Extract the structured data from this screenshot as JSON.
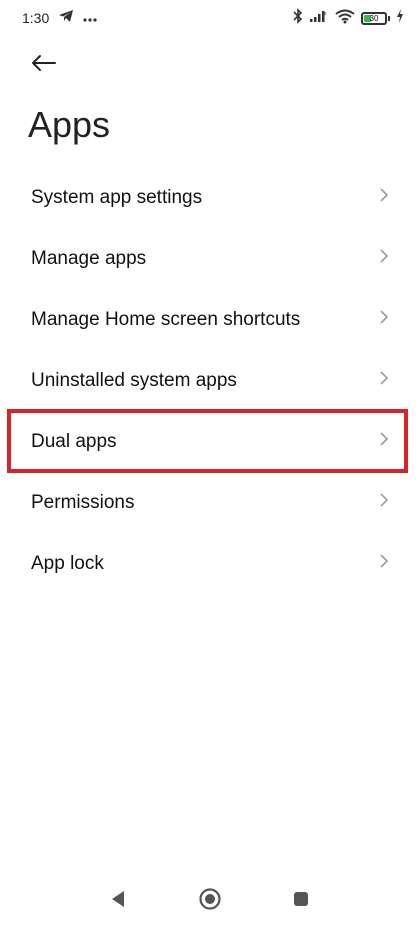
{
  "status_bar": {
    "time": "1:30",
    "battery_level": "30",
    "icons": [
      "telegram-icon",
      "more-dots-icon",
      "bluetooth-icon",
      "signal-icon",
      "wifi-icon",
      "battery-icon",
      "charging-icon"
    ]
  },
  "header": {
    "back_icon": "back-arrow-icon",
    "title": "Apps"
  },
  "menu": {
    "items": [
      {
        "label": "System app settings"
      },
      {
        "label": "Manage apps"
      },
      {
        "label": "Manage Home screen shortcuts"
      },
      {
        "label": "Uninstalled system apps"
      },
      {
        "label": "Dual apps",
        "highlighted": true
      },
      {
        "label": "Permissions"
      },
      {
        "label": "App lock"
      }
    ]
  },
  "colors": {
    "highlight": "#d8232a",
    "battery_fill": "#3db84c",
    "chevron": "#9a9a9a"
  },
  "nav_bar": {
    "icons": [
      "nav-back-icon",
      "nav-home-icon",
      "nav-recents-icon"
    ]
  }
}
